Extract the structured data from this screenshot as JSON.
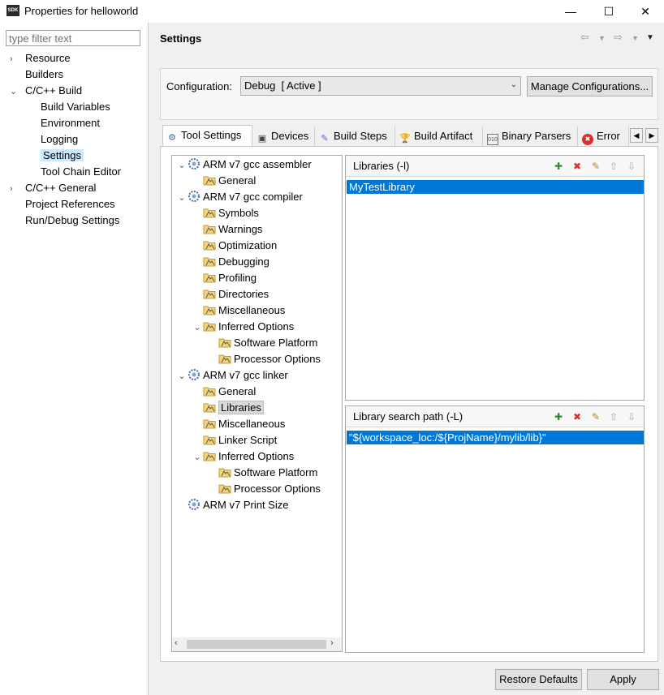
{
  "window": {
    "app_icon_text": "SDK",
    "title": "Properties for helloworld",
    "minimize_glyph": "—",
    "maximize_glyph": "☐",
    "close_glyph": "✕"
  },
  "filter": {
    "placeholder": "type filter text",
    "value": ""
  },
  "nav": {
    "items": [
      {
        "label": "Resource",
        "indent": 0,
        "arrow": "›"
      },
      {
        "label": "Builders",
        "indent": 0,
        "arrow": ""
      },
      {
        "label": "C/C++ Build",
        "indent": 0,
        "arrow": "⌄"
      },
      {
        "label": "Build Variables",
        "indent": 1,
        "arrow": ""
      },
      {
        "label": "Environment",
        "indent": 1,
        "arrow": ""
      },
      {
        "label": "Logging",
        "indent": 1,
        "arrow": ""
      },
      {
        "label": "Settings",
        "indent": 1,
        "arrow": "",
        "selected": true
      },
      {
        "label": "Tool Chain Editor",
        "indent": 1,
        "arrow": ""
      },
      {
        "label": "C/C++ General",
        "indent": 0,
        "arrow": "›"
      },
      {
        "label": "Project References",
        "indent": 0,
        "arrow": ""
      },
      {
        "label": "Run/Debug Settings",
        "indent": 0,
        "arrow": ""
      }
    ]
  },
  "header": {
    "title": "Settings"
  },
  "config": {
    "label": "Configuration:",
    "selected": "Debug  [ Active ]",
    "manage_button": "Manage Configurations..."
  },
  "tabs": [
    {
      "label": "Tool Settings",
      "icon": "tool-settings-icon",
      "active": true
    },
    {
      "label": "Devices",
      "icon": "devices-icon"
    },
    {
      "label": "Build Steps",
      "icon": "build-steps-icon"
    },
    {
      "label": "Build Artifact",
      "icon": "build-artifact-icon"
    },
    {
      "label": "Binary Parsers",
      "icon": "binary-parsers-icon"
    },
    {
      "label": "Error",
      "icon": "error-icon"
    }
  ],
  "tree": [
    {
      "label": "ARM v7 gcc assembler",
      "level": 0,
      "type": "tool",
      "twisty": "⌄"
    },
    {
      "label": "General",
      "level": 1,
      "type": "folder"
    },
    {
      "label": "ARM v7 gcc compiler",
      "level": 0,
      "type": "tool",
      "twisty": "⌄"
    },
    {
      "label": "Symbols",
      "level": 1,
      "type": "folder"
    },
    {
      "label": "Warnings",
      "level": 1,
      "type": "folder"
    },
    {
      "label": "Optimization",
      "level": 1,
      "type": "folder"
    },
    {
      "label": "Debugging",
      "level": 1,
      "type": "folder"
    },
    {
      "label": "Profiling",
      "level": 1,
      "type": "folder"
    },
    {
      "label": "Directories",
      "level": 1,
      "type": "folder"
    },
    {
      "label": "Miscellaneous",
      "level": 1,
      "type": "folder"
    },
    {
      "label": "Inferred Options",
      "level": 1,
      "type": "folder",
      "twisty": "⌄"
    },
    {
      "label": "Software Platform",
      "level": 2,
      "type": "folder"
    },
    {
      "label": "Processor Options",
      "level": 2,
      "type": "folder"
    },
    {
      "label": "ARM v7 gcc linker",
      "level": 0,
      "type": "tool",
      "twisty": "⌄"
    },
    {
      "label": "General",
      "level": 1,
      "type": "folder"
    },
    {
      "label": "Libraries",
      "level": 1,
      "type": "folder",
      "selected": true
    },
    {
      "label": "Miscellaneous",
      "level": 1,
      "type": "folder"
    },
    {
      "label": "Linker Script",
      "level": 1,
      "type": "folder"
    },
    {
      "label": "Inferred Options",
      "level": 1,
      "type": "folder",
      "twisty": "⌄"
    },
    {
      "label": "Software Platform",
      "level": 2,
      "type": "folder"
    },
    {
      "label": "Processor Options",
      "level": 2,
      "type": "folder"
    },
    {
      "label": "ARM v7 Print Size",
      "level": 0,
      "type": "tool"
    }
  ],
  "libraries": {
    "title": "Libraries (-l)",
    "items": [
      "MyTestLibrary"
    ]
  },
  "library_paths": {
    "title": "Library search path (-L)",
    "items": [
      "\"${workspace_loc:/${ProjName}/mylib/lib}\""
    ]
  },
  "buttons": {
    "restore": "Restore Defaults",
    "apply": "Apply"
  },
  "colors": {
    "selection": "#0078d7",
    "nav_selected": "#cce8ff",
    "tree_selected": "#d9d9d9"
  }
}
